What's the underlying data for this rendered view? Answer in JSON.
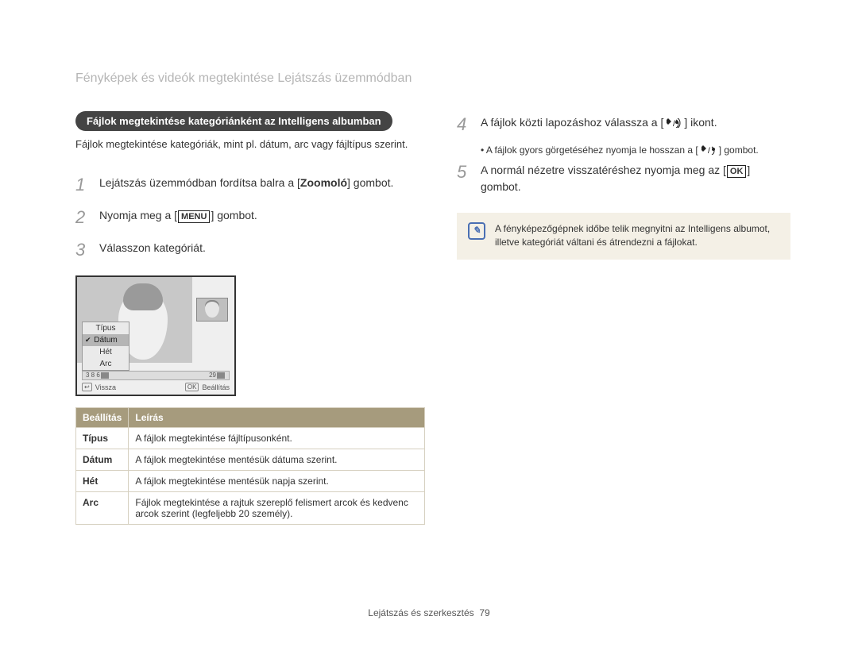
{
  "header": {
    "title": "Fényképek és videók megtekintése Lejátszás üzemmódban"
  },
  "left": {
    "pill": "Fájlok megtekintése kategóriánként az Intelligens albumban",
    "intro": "Fájlok megtekintése kategóriák, mint pl. dátum, arc vagy fájltípus szerint.",
    "steps": [
      {
        "n": "1",
        "pre": "Lejátszás üzemmódban fordítsa balra a [",
        "bold": "Zoomoló",
        "post": "] gombot."
      },
      {
        "n": "2",
        "pre": "Nyomja meg a [",
        "label": "MENU",
        "post": "] gombot."
      },
      {
        "n": "3",
        "text": "Válasszon kategóriát."
      }
    ],
    "lcd": {
      "menu": [
        "Típus",
        "Dátum",
        "Hét",
        "Arc"
      ],
      "selectedIndex": 1,
      "strip_left": "3  8  6",
      "strip_right": "29",
      "back_label": "Vissza",
      "ok_key": "OK",
      "set_label": "Beállítás"
    },
    "table": {
      "h1": "Beállítás",
      "h2": "Leírás",
      "rows": [
        {
          "k": "Típus",
          "v": "A fájlok megtekintése fájltípusonként."
        },
        {
          "k": "Dátum",
          "v": "A fájlok megtekintése mentésük dátuma szerint."
        },
        {
          "k": "Hét",
          "v": "A fájlok megtekintése mentésük napja szerint."
        },
        {
          "k": "Arc",
          "v": "Fájlok megtekintése a rajtuk szereplő felismert arcok és kedvenc arcok szerint (legfeljebb 20 személy)."
        }
      ]
    }
  },
  "right": {
    "steps": [
      {
        "n": "4",
        "pre": "A fájlok közti lapozáshoz válassza a [",
        "icons": "pair",
        "post": "] ikont."
      },
      {
        "bullet": true,
        "pre": "A fájlok gyors görgetéséhez nyomja le hosszan a [",
        "icons": "pair",
        "post": "] gombot."
      },
      {
        "n": "5",
        "pre": "A normál nézetre visszatéréshez nyomja meg az [",
        "label": "OK",
        "post": "] gombot."
      }
    ],
    "note": "A fényképezőgépnek időbe telik megnyitni az Intelligens albumot, illetve kategóriát váltani és átrendezni a fájlokat."
  },
  "footer": {
    "section": "Lejátszás és szerkesztés",
    "page": "79"
  }
}
